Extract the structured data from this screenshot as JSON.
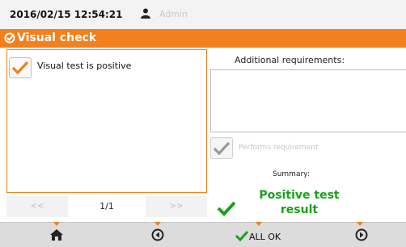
{
  "status": {
    "datetime": "2016/02/15 12:54:21",
    "user": "Admin"
  },
  "titlebar": {
    "title": "Visual check",
    "accent_color": "#f1801d"
  },
  "checklist": {
    "item_1_label": "Visual test is positive",
    "item_1_checked": true
  },
  "pager": {
    "prev_label": "<<",
    "page": "1/1",
    "next_label": ">>"
  },
  "additional": {
    "label": "Additional requirements:",
    "value": "",
    "requirement_label": "Performs requirement",
    "requirement_checked": true
  },
  "summary": {
    "label": "Summary:",
    "result": "Positive test result",
    "result_color": "#1aa01a"
  },
  "toolbar": {
    "home_icon": "home-icon",
    "back_icon": "back-icon",
    "allok_label": "ALL OK",
    "next_icon": "next-icon"
  }
}
